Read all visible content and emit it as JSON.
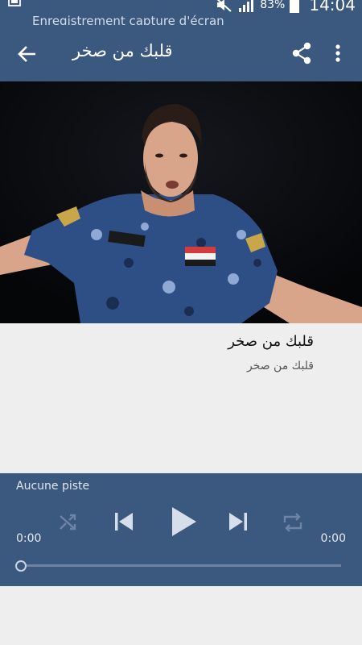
{
  "status_bar": {
    "notification_title": "Enregistrement capture d'écran",
    "battery": "83%",
    "time": "14:04",
    "icons": [
      "screen-record-icon",
      "mute-icon",
      "signal-icon",
      "battery-icon"
    ]
  },
  "app_bar": {
    "title": "قلبك من صخر",
    "icons": [
      "back-arrow-icon",
      "share-icon",
      "more-vert-icon"
    ]
  },
  "track": {
    "title": "قلبك من صخر",
    "subtitle": "قلبك من صخر"
  },
  "player": {
    "no_track_label": "Aucune piste",
    "time_elapsed": "0:00",
    "time_total": "0:00",
    "progress": 0,
    "icons": [
      "shuffle-icon",
      "previous-icon",
      "play-icon",
      "next-icon",
      "repeat-icon"
    ]
  },
  "colors": {
    "primary": "#3b587f",
    "background": "#eeeeee"
  }
}
